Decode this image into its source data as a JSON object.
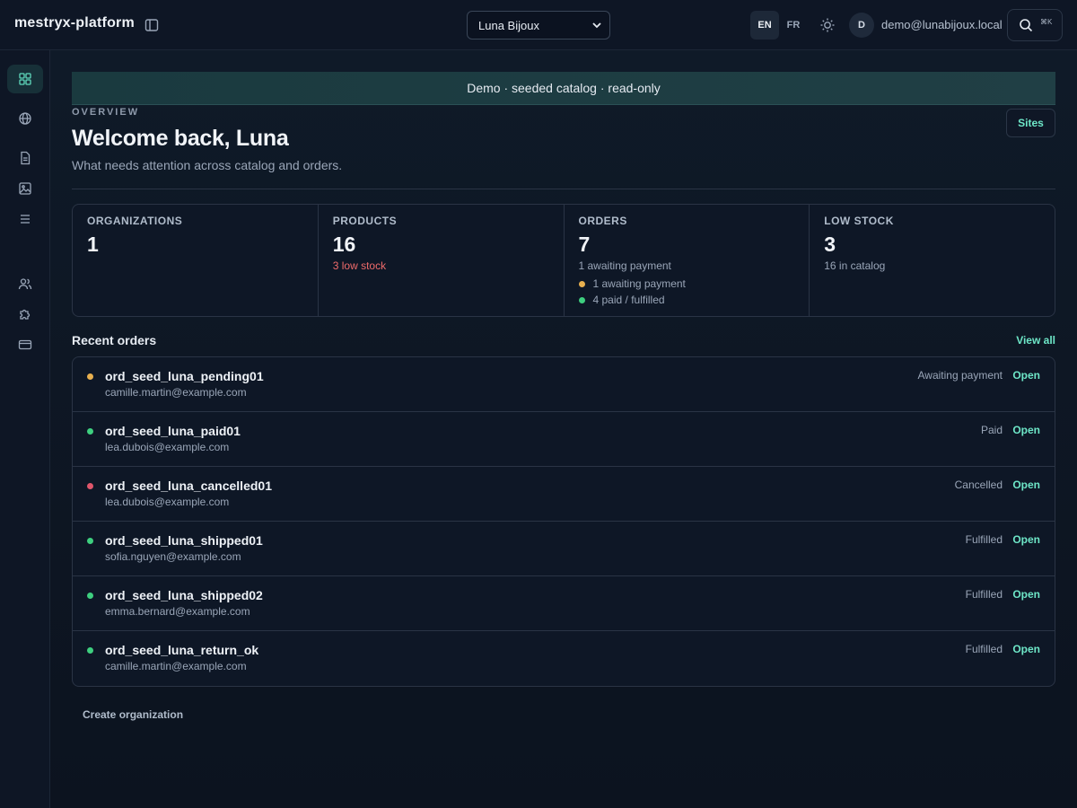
{
  "header": {
    "brand": "mestryx-platform",
    "site_selected": "Luna Bijoux",
    "languages": [
      {
        "label": "EN",
        "active": true
      },
      {
        "label": "FR",
        "active": false
      }
    ],
    "avatar_initial": "D",
    "user_email": "demo@lunabijoux.local",
    "search_shortcut": "⌘K"
  },
  "sidebar": {
    "items": [
      {
        "icon": "dashboard-icon",
        "active": true
      },
      {
        "icon": "globe-icon",
        "active": false
      },
      {
        "icon": "document-icon",
        "active": false
      },
      {
        "icon": "image-icon",
        "active": false
      },
      {
        "icon": "list-icon",
        "active": false
      },
      {
        "icon": "users-icon",
        "active": false
      },
      {
        "icon": "puzzle-icon",
        "active": false
      },
      {
        "icon": "credit-card-icon",
        "active": false
      }
    ]
  },
  "banner": "Demo · seeded catalog · read-only",
  "overview": {
    "eyebrow": "OVERVIEW",
    "title": "Welcome back, Luna",
    "subtitle": "What needs attention across catalog and orders.",
    "sites_button": "Sites"
  },
  "stats": {
    "organizations": {
      "label": "ORGANIZATIONS",
      "value": "1"
    },
    "products": {
      "label": "PRODUCTS",
      "value": "16",
      "note": "3 low stock"
    },
    "orders": {
      "label": "ORDERS",
      "value": "7",
      "note": "1 awaiting payment",
      "legend": [
        {
          "label": "1 awaiting payment",
          "color": "#e8b04f"
        },
        {
          "label": "4 paid / fulfilled",
          "color": "#3ecf7f"
        }
      ]
    },
    "low_stock": {
      "label": "LOW STOCK",
      "value": "3",
      "note": "16 in catalog"
    }
  },
  "recent_orders": {
    "title": "Recent orders",
    "view_all": "View all",
    "open_label": "Open",
    "rows": [
      {
        "id": "ord_seed_luna_pending01",
        "email": "camille.martin@example.com",
        "status": "Awaiting payment",
        "color": "#e8b04f"
      },
      {
        "id": "ord_seed_luna_paid01",
        "email": "lea.dubois@example.com",
        "status": "Paid",
        "color": "#3ecf7f"
      },
      {
        "id": "ord_seed_luna_cancelled01",
        "email": "lea.dubois@example.com",
        "status": "Cancelled",
        "color": "#e0566b"
      },
      {
        "id": "ord_seed_luna_shipped01",
        "email": "sofia.nguyen@example.com",
        "status": "Fulfilled",
        "color": "#3ecf7f"
      },
      {
        "id": "ord_seed_luna_shipped02",
        "email": "emma.bernard@example.com",
        "status": "Fulfilled",
        "color": "#3ecf7f"
      },
      {
        "id": "ord_seed_luna_return_ok",
        "email": "camille.martin@example.com",
        "status": "Fulfilled",
        "color": "#3ecf7f"
      }
    ]
  },
  "create_organization": "Create organization"
}
